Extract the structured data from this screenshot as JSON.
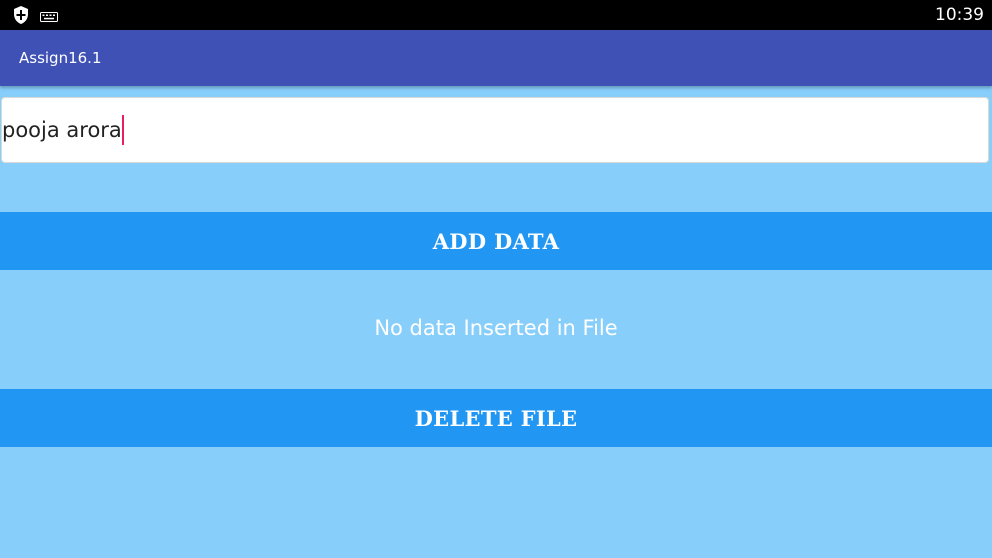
{
  "status_bar": {
    "time": "10:39",
    "icons": [
      "shield-icon",
      "keyboard-icon"
    ]
  },
  "app_bar": {
    "title": "Assign16.1"
  },
  "input": {
    "value": "pooja arora"
  },
  "buttons": {
    "add_label": "ADD DATA",
    "delete_label": "DELETE FILE"
  },
  "message": "No data Inserted in File",
  "colors": {
    "background": "#87cefa",
    "app_bar": "#3f51b5",
    "button": "#2196f3",
    "caret": "#e91e63"
  }
}
